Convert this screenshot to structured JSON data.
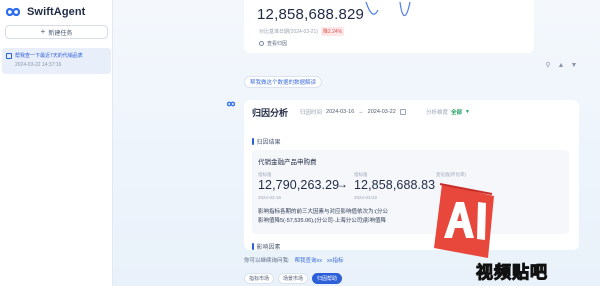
{
  "app": {
    "name": "SwiftAgent"
  },
  "sidebar": {
    "new_task_label": "新建任务",
    "tasks": [
      {
        "title": "帮我查一下最近7天的代销品表",
        "time": "2024-03-22 14:37:16"
      }
    ]
  },
  "top_card": {
    "value": "12,858,688.829",
    "date_text": "对比基准日期(2024-03-21)",
    "delta": "降2.24%",
    "link_label": "查看归因"
  },
  "help_link": "帮我做这个数据的数据解读",
  "analysis": {
    "title": "归因分析",
    "date_label": "归因时间",
    "date_start": "2024-03-16",
    "date_sep": "→",
    "date_end": "2024-03-22",
    "dim_label": "分析维度",
    "dim_value": "全部",
    "result_head": "归因结果",
    "factor_head": "影响因素",
    "product": "代销金融产品申购费",
    "kpi_left_label": "指标值",
    "kpi_left_value": "12,790,263.29",
    "kpi_left_date": "2024-03-16",
    "kpi_right_label": "指标值",
    "kpi_right_value": "12,858,688.83",
    "kpi_right_date": "2024-03-22",
    "change_label": "变化值(环比率)",
    "explain_line1": "影响指标各期的前三大因素与对应影响值依次为:(分公",
    "explain_line2": "影响值降5(-57,535.06),(分公司-上海分公司)影响值降"
  },
  "suggestions": {
    "prompt": "你可以继续询问我:",
    "links": [
      "帮我查询xx",
      "xx指标"
    ]
  },
  "chips": [
    "指标市场",
    "场景市场",
    "归因帮助"
  ],
  "watermark": {
    "text": "AI",
    "caption": "视频贴吧"
  },
  "colors": {
    "accent": "#2c5fd8",
    "positive": "#1f9e62",
    "negative": "#e25757"
  }
}
